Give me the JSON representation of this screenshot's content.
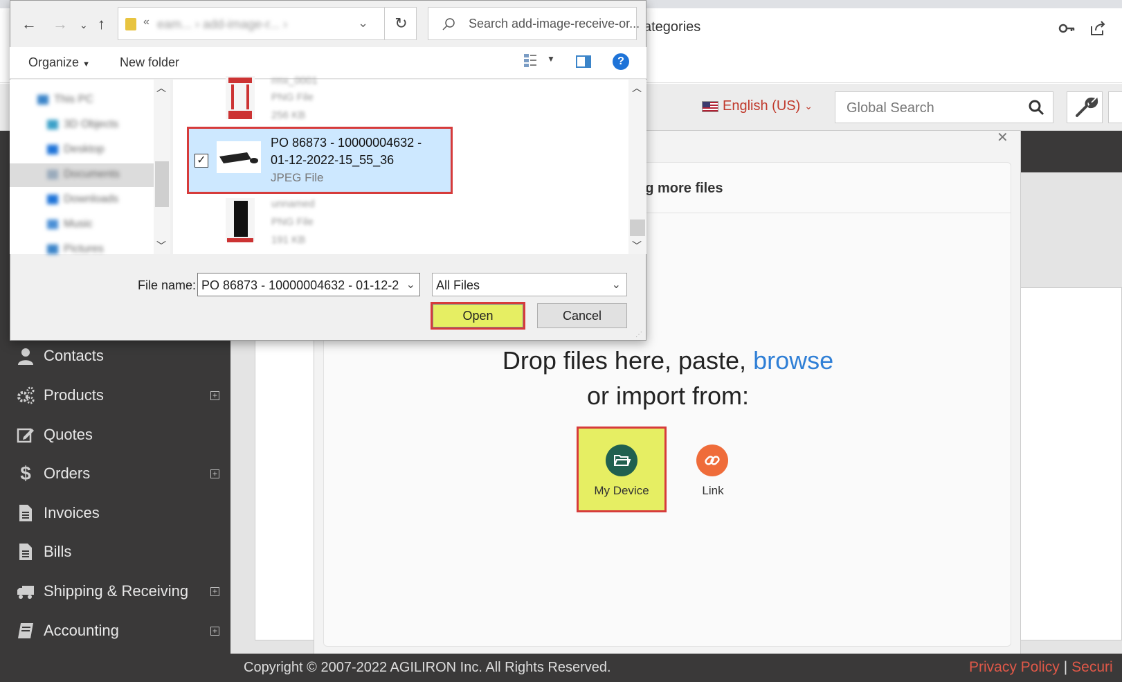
{
  "browser": {
    "address_fragment": "ategories"
  },
  "header": {
    "language": "English (US)",
    "global_search_placeholder": "Global Search"
  },
  "sidebar": {
    "items": [
      {
        "label": "Contacts",
        "expandable": false,
        "icon": "user-icon"
      },
      {
        "label": "Products",
        "expandable": true,
        "icon": "gears-icon"
      },
      {
        "label": "Quotes",
        "expandable": false,
        "icon": "edit-icon"
      },
      {
        "label": "Orders",
        "expandable": true,
        "icon": "dollar-icon"
      },
      {
        "label": "Invoices",
        "expandable": false,
        "icon": "document-icon"
      },
      {
        "label": "Bills",
        "expandable": false,
        "icon": "document-icon"
      },
      {
        "label": "Shipping & Receiving",
        "expandable": true,
        "icon": "truck-icon"
      },
      {
        "label": "Accounting",
        "expandable": true,
        "icon": "book-icon"
      }
    ],
    "expand_symbol": "+"
  },
  "upload_modal": {
    "close_symbol": "✕",
    "header_fragment": "ng more files",
    "drop_text_prefix": "Drop files here, paste, ",
    "browse_label": "browse",
    "drop_text_line2": "or import from:",
    "sources": [
      {
        "label": "My Device",
        "icon": "folder-open-icon"
      },
      {
        "label": "Link",
        "icon": "link-icon"
      }
    ]
  },
  "footer": {
    "copyright": "Copyright © 2007-2022 AGILIRON Inc. All Rights Reserved.",
    "privacy_label": "Privacy Policy",
    "separator": "|",
    "security_label": "Securi"
  },
  "file_dialog": {
    "path_chevron": "«",
    "path_blurred": "eam... › add-image-r... ›",
    "search_placeholder": "Search add-image-receive-or...",
    "organize_label": "Organize",
    "new_folder_label": "New folder",
    "help_symbol": "?",
    "tree_items": [
      "This PC",
      "3D Objects",
      "Desktop",
      "Documents",
      "Downloads",
      "Music",
      "Pictures"
    ],
    "files_blurred": [
      {
        "name": "rmx_0001",
        "type": "PNG File",
        "size": "256 KB"
      },
      {
        "name": "unnamed",
        "type": "PNG File",
        "size": "191 KB"
      }
    ],
    "selected_file": {
      "name_line1": "PO 86873 - 10000004632 -",
      "name_line2": "01-12-2022-15_55_36",
      "type": "JPEG File",
      "checked": true,
      "check_symbol": "✓"
    },
    "file_name_label": "File name:",
    "file_name_value": "PO 86873 - 10000004632 - 01-12-2",
    "file_type_value": "All Files",
    "open_label": "Open",
    "cancel_label": "Cancel"
  },
  "colors": {
    "sidebar_bg": "#3a3939",
    "highlight_yellow": "#e6ee63",
    "highlight_red": "#d63b3b",
    "link_blue": "#2f7fd6",
    "device_green": "#20604f",
    "link_orange": "#ef6c3a",
    "footer_link_red": "#e05848"
  }
}
